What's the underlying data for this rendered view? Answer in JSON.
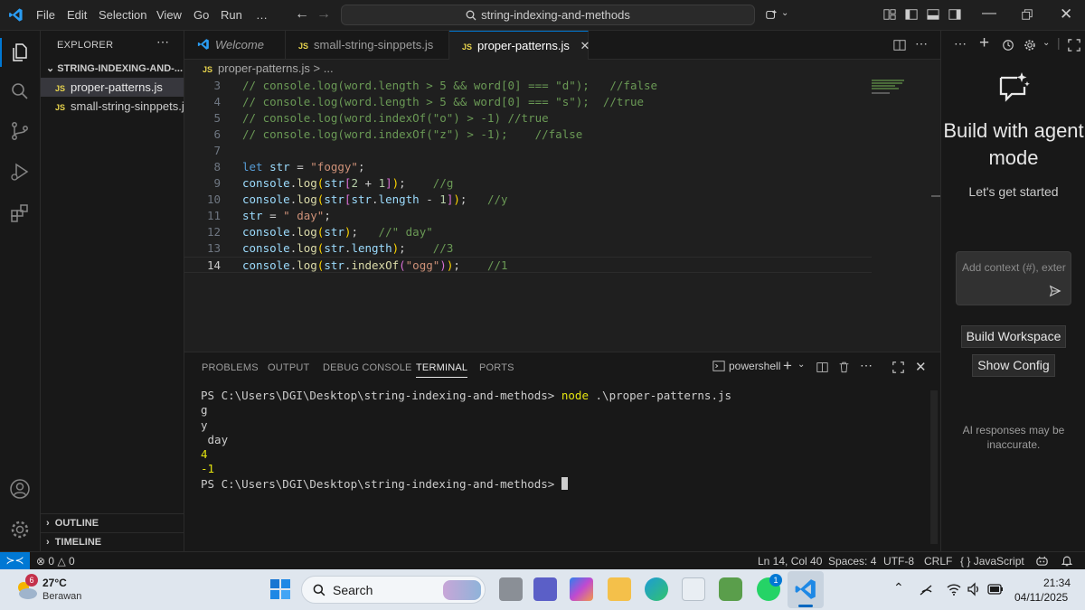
{
  "titlebar": {
    "menu": [
      "File",
      "Edit",
      "Selection",
      "View",
      "Go",
      "Run",
      "…"
    ],
    "search": "string-indexing-and-methods"
  },
  "explorer": {
    "title": "EXPLORER",
    "folder": "STRING-INDEXING-AND-...",
    "files": [
      "proper-patterns.js",
      "small-string-sinppets.js"
    ],
    "outline": "OUTLINE",
    "timeline": "TIMELINE"
  },
  "tabs": [
    {
      "label": "Welcome",
      "badge": ""
    },
    {
      "label": "small-string-sinppets.js",
      "badge": "JS"
    },
    {
      "label": "proper-patterns.js",
      "badge": "JS"
    }
  ],
  "breadcrumb": {
    "file": "proper-patterns.js",
    "rest": "> ..."
  },
  "editor": {
    "line_numbers": [
      "3",
      "4",
      "5",
      "6",
      "7",
      "8",
      "9",
      "10",
      "11",
      "12",
      "13",
      "14"
    ]
  },
  "panel": {
    "tabs": [
      "PROBLEMS",
      "OUTPUT",
      "DEBUG CONSOLE",
      "TERMINAL",
      "PORTS"
    ],
    "shell": "powershell",
    "terminal": {
      "prompt": "PS C:\\Users\\DGI\\Desktop\\string-indexing-and-methods>",
      "command": "node",
      "arg": ".\\proper-patterns.js",
      "output": [
        "g",
        "y",
        " day",
        "4",
        "-1"
      ]
    }
  },
  "chat": {
    "title": "Build with agent mode",
    "subtitle": "Let's get started",
    "input_placeholder": "Add context (#), exter",
    "btn_workspace": "Build Workspace",
    "btn_config": "Show Config",
    "disclaimer": "AI responses may be inaccurate."
  },
  "statusbar": {
    "errors": "0",
    "warnings": "0",
    "position": "Ln 14, Col 40",
    "spaces": "Spaces: 4",
    "encoding": "UTF-8",
    "eol": "CRLF",
    "language": "JavaScript"
  },
  "taskbar": {
    "weather_temp": "27°C",
    "weather_desc": "Berawan",
    "weather_badge": "6",
    "search": "Search",
    "teams_badge": "1",
    "time": "21:34",
    "date": "04/11/2025"
  },
  "colors": {
    "accent": "#0078d4",
    "remote_badge": "#0078d4",
    "js_badge": "#e8d44d",
    "comment": "#6a9955",
    "keyword": "#569cd6",
    "string": "#ce9178",
    "function": "#dcdcaa",
    "terminal_yellow": "#e5e510"
  }
}
